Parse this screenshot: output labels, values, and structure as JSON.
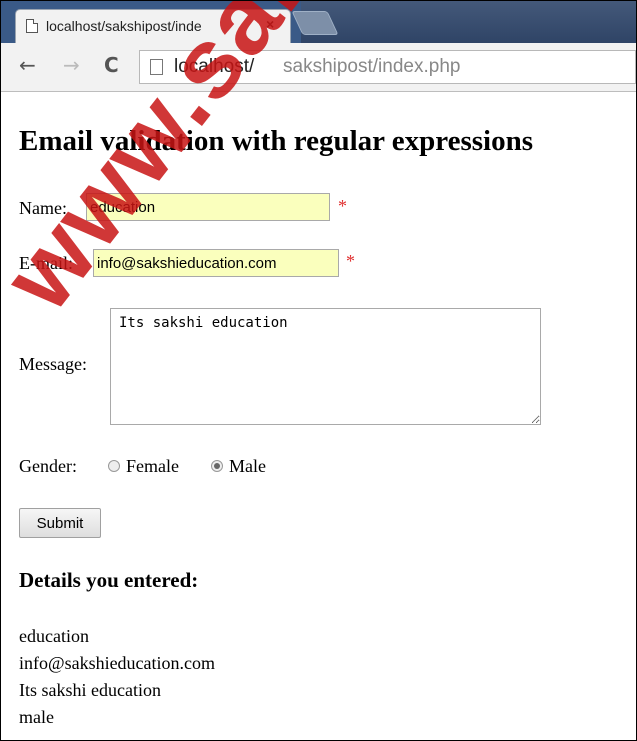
{
  "browser": {
    "tab_title": "localhost/sakshipost/inde",
    "tab_close": "×",
    "url_host": "localhost/",
    "url_path": "sakshipost/index.php",
    "back_icon": "←",
    "forward_icon": "→",
    "reload_icon": "C"
  },
  "page": {
    "heading": "Email validation with regular expressions",
    "form": {
      "name_label": "Name:",
      "name_value": "education",
      "email_label": "E-mail:",
      "email_value": "info@sakshieducation.com",
      "required_mark": "*",
      "message_label": "Message:",
      "message_value": "Its sakshi education",
      "gender_label": "Gender:",
      "gender_options": [
        "Female",
        "Male"
      ],
      "gender_selected": "Male",
      "submit_label": "Submit"
    },
    "details_heading": "Details you entered:",
    "details": [
      "education",
      "info@sakshieducation.com",
      "Its sakshi education",
      "male"
    ]
  },
  "watermark": "www.sakshieducation",
  "colors": {
    "autofill_bg": "#faffbd",
    "required": "#e03030",
    "watermark": "#c81414"
  }
}
